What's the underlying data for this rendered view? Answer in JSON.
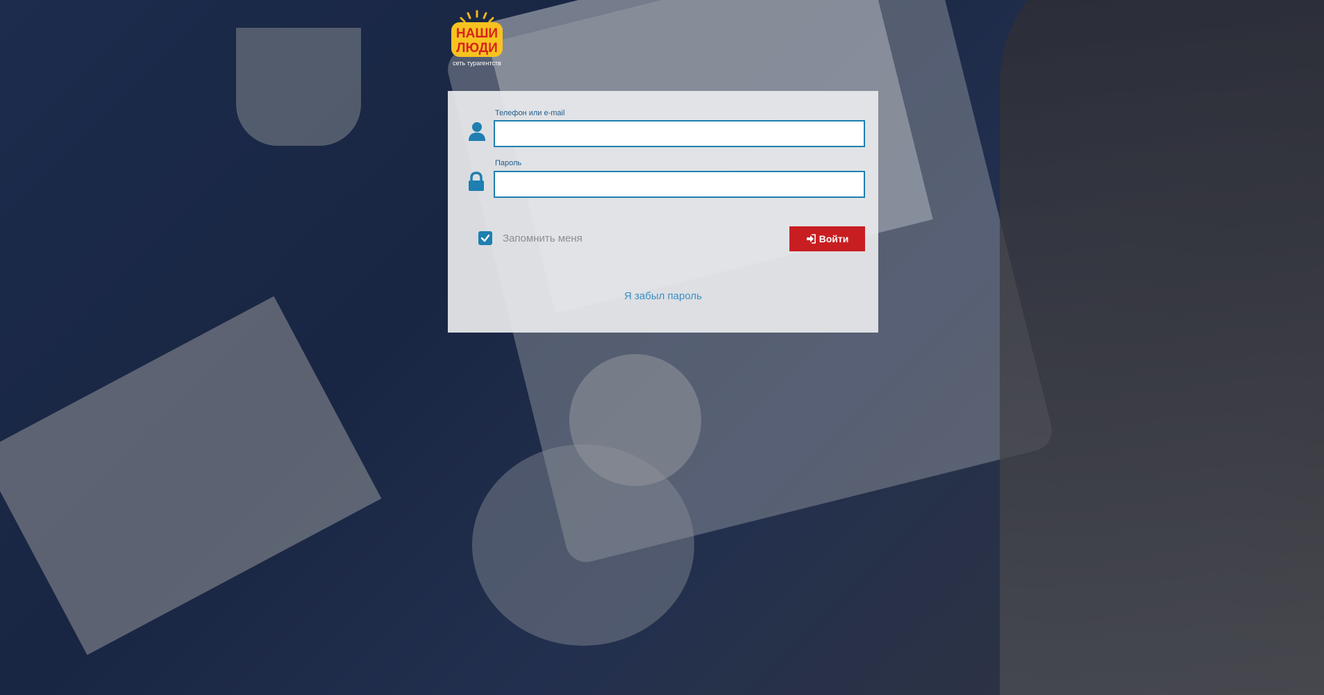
{
  "brand": {
    "logo_line1": "НАШИ",
    "logo_line2": "ЛЮДИ",
    "logo_tagline": "сеть турагентств"
  },
  "login": {
    "login_label": "Телефон или e-mail",
    "login_value": "",
    "password_label": "Пароль",
    "password_value": "",
    "remember_label": "Запомнить меня",
    "remember_checked": true,
    "submit_label": "Войти",
    "forgot_label": "Я забыл пароль"
  },
  "colors": {
    "accent": "#1e7fb0",
    "button": "#c81e22",
    "link": "#3a8fc4"
  },
  "icons": {
    "login_icon": "user-icon",
    "password_icon": "lock-icon",
    "checkbox_icon": "check-icon",
    "button_icon": "sign-in-icon"
  }
}
